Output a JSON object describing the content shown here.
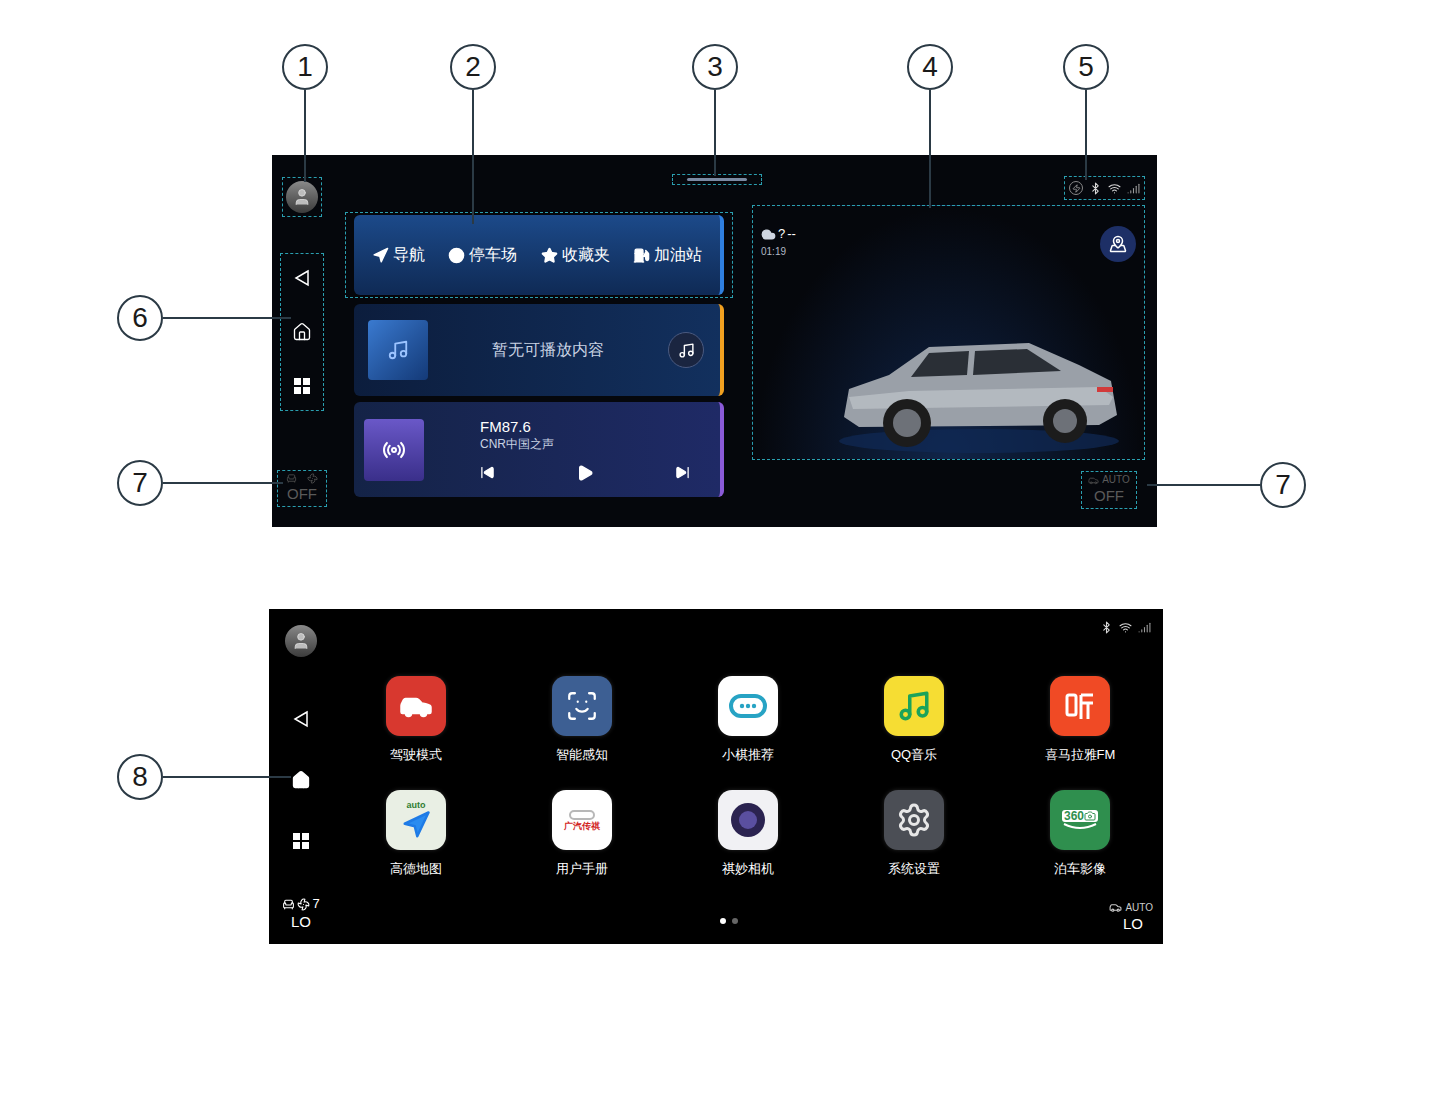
{
  "callouts": [
    {
      "label": "1"
    },
    {
      "label": "2"
    },
    {
      "label": "3"
    },
    {
      "label": "4"
    },
    {
      "label": "5"
    },
    {
      "label": "6"
    },
    {
      "label": "7"
    },
    {
      "label": "7"
    },
    {
      "label": "8"
    }
  ],
  "top_screen": {
    "nav_rail": [
      {
        "name": "back",
        "selected": false
      },
      {
        "name": "home",
        "selected": false
      },
      {
        "name": "apps",
        "selected": false
      }
    ],
    "shortcuts": [
      {
        "label": "导航"
      },
      {
        "label": "停车场"
      },
      {
        "label": "收藏夹"
      },
      {
        "label": "加油站"
      }
    ],
    "media_card": {
      "text": "暂无可播放内容"
    },
    "radio_card": {
      "frequency": "FM87.6",
      "station": "CNR中国之声",
      "playing": false
    },
    "weather": {
      "icon_text": "?",
      "temperature": "--",
      "time": "01:19"
    },
    "climate_left": {
      "value": "OFF"
    },
    "climate_right": {
      "mode": "AUTO",
      "value": "OFF"
    }
  },
  "bottom_screen": {
    "nav_rail": [
      {
        "name": "back",
        "selected": false
      },
      {
        "name": "home",
        "selected": true
      },
      {
        "name": "apps",
        "selected": false
      }
    ],
    "apps": [
      {
        "label": "驾驶模式",
        "icon_text": "",
        "color": "#d8382f"
      },
      {
        "label": "智能感知",
        "icon_text": "",
        "color": "#3d5f93"
      },
      {
        "label": "小棋推荐",
        "icon_text": "",
        "color": "#ffffff"
      },
      {
        "label": "QQ音乐",
        "icon_text": "",
        "color": "#f6dd33"
      },
      {
        "label": "喜马拉雅FM",
        "icon_text": "",
        "color": "#f04a25"
      },
      {
        "label": "高德地图",
        "icon_text": "auto",
        "color": "#e9efe4"
      },
      {
        "label": "用户手册",
        "icon_text": "广汽传祺",
        "color": "#ffffff"
      },
      {
        "label": "祺妙相机",
        "icon_text": "",
        "color": "#f1f1f4"
      },
      {
        "label": "系统设置",
        "icon_text": "",
        "color": "#4b4e55"
      },
      {
        "label": "泊车影像",
        "icon_text": "360",
        "color": "#2f8f4e"
      }
    ],
    "pages": [
      {
        "selected": true
      },
      {
        "selected": false
      }
    ],
    "climate_left": {
      "fan": "7",
      "value": "LO"
    },
    "climate_right": {
      "mode": "AUTO",
      "value": "LO"
    }
  }
}
